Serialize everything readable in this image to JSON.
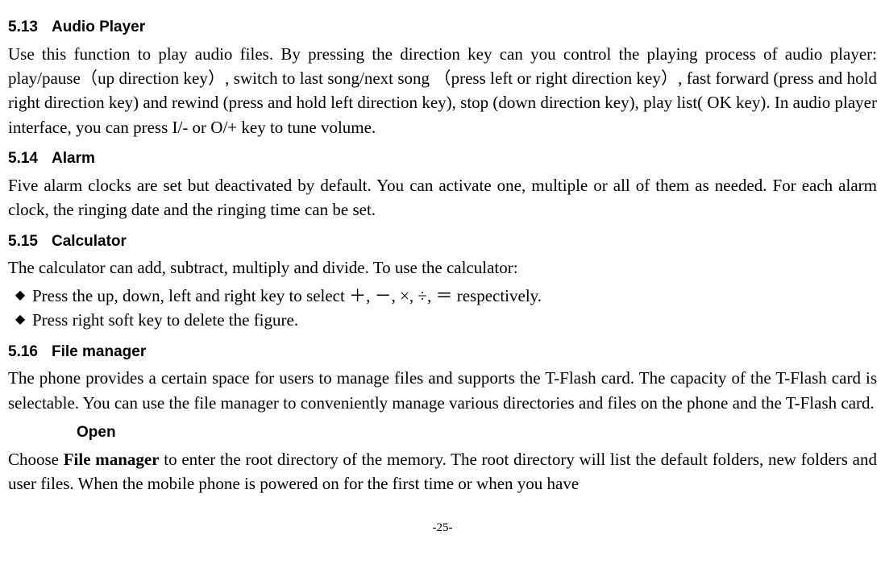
{
  "sections": {
    "s513": {
      "num": "5.13",
      "title": "Audio Player",
      "body": "Use this function to play audio files. By pressing the direction key can you control the playing process of audio player: play/pause（up direction key）, switch to last song/next song （press left or right direction key）, fast forward (press and hold right direction key) and rewind (press and hold left direction key), stop (down direction key), play list( OK key). In audio player interface, you can press I/- or O/+ key to tune volume."
    },
    "s514": {
      "num": "5.14",
      "title": "Alarm",
      "body": "Five alarm clocks are set but deactivated by default. You can activate one, multiple or all of them as needed. For each alarm clock, the ringing date and the ringing time can be set."
    },
    "s515": {
      "num": "5.15",
      "title": "Calculator",
      "intro": "The calculator can add, subtract, multiply and divide. To use the calculator:",
      "bullets": [
        "Press the up, down, left and right key to select ＋, －, ×, ÷, ＝ respectively.",
        "Press right soft key to delete the figure."
      ]
    },
    "s516": {
      "num": "5.16",
      "title": "File manager",
      "body": "The phone provides a certain space for users to manage files and supports the T-Flash card. The capacity of the T-Flash card is selectable. You can use the file manager to conveniently manage various directories and files on the phone and the T-Flash card.",
      "sub": {
        "title": "Open",
        "body_prefix": "Choose ",
        "body_bold": "File manager",
        "body_suffix": " to enter the root directory of the memory. The root directory will list the default folders, new folders and user files. When the mobile phone is powered on for the first time or when you have"
      }
    }
  },
  "page_number": "-25-"
}
